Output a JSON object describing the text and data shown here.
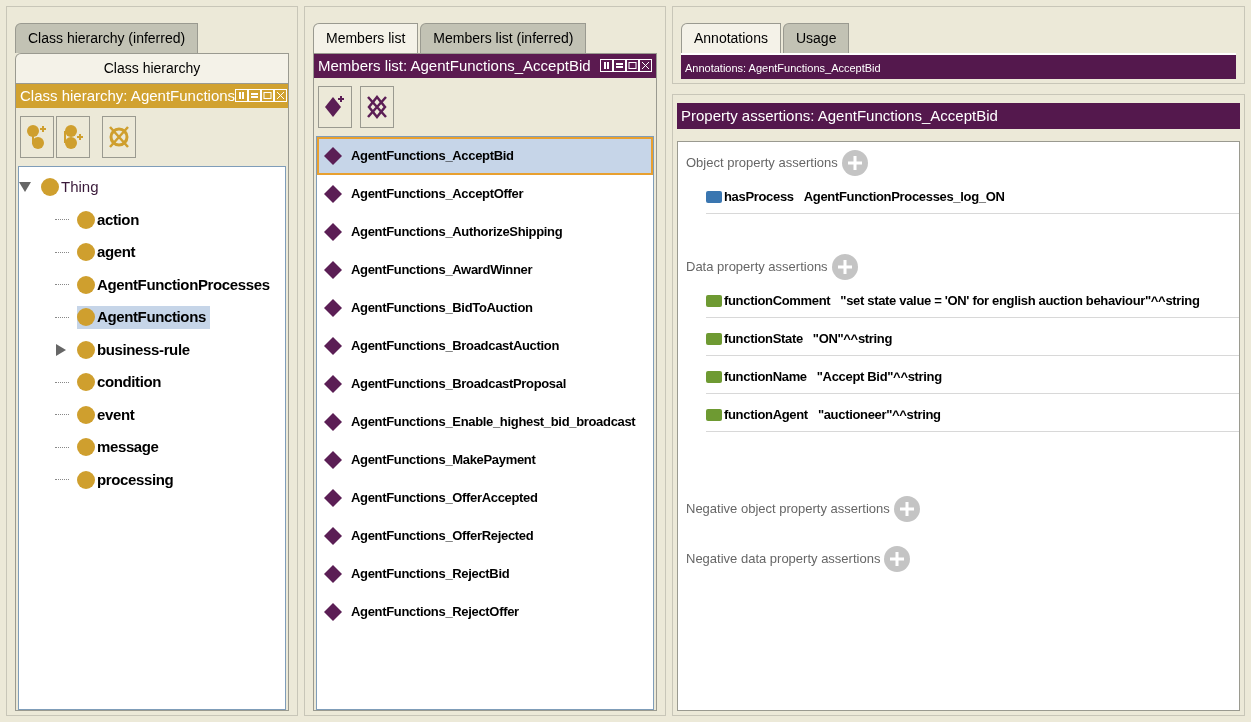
{
  "class_panel": {
    "tabs": [
      {
        "label": "Class hierarchy (inferred)",
        "selected": false
      },
      {
        "label": "Class hierarchy",
        "selected": true
      }
    ],
    "header": "Class hierarchy: AgentFunctions",
    "tree": [
      {
        "label": "Thing",
        "expanded": true,
        "selected": false,
        "children": [
          {
            "label": "action",
            "selected": false
          },
          {
            "label": "agent",
            "selected": false
          },
          {
            "label": "AgentFunctionProcesses",
            "selected": false
          },
          {
            "label": "AgentFunctions",
            "selected": true
          },
          {
            "label": "business-rule",
            "selected": false,
            "expanded": false
          },
          {
            "label": "condition",
            "selected": false
          },
          {
            "label": "event",
            "selected": false
          },
          {
            "label": "message",
            "selected": false
          },
          {
            "label": "processing",
            "selected": false
          }
        ]
      }
    ]
  },
  "members_panel": {
    "tabs": [
      {
        "label": "Members list",
        "selected": true
      },
      {
        "label": "Members list (inferred)",
        "selected": false
      }
    ],
    "header": "Members list: AgentFunctions_AcceptBid",
    "items": [
      {
        "label": "AgentFunctions_AcceptBid",
        "selected": true
      },
      {
        "label": "AgentFunctions_AcceptOffer",
        "selected": false
      },
      {
        "label": "AgentFunctions_AuthorizeShipping",
        "selected": false
      },
      {
        "label": "AgentFunctions_AwardWinner",
        "selected": false
      },
      {
        "label": "AgentFunctions_BidToAuction",
        "selected": false
      },
      {
        "label": "AgentFunctions_BroadcastAuction",
        "selected": false
      },
      {
        "label": "AgentFunctions_BroadcastProposal",
        "selected": false
      },
      {
        "label": "AgentFunctions_Enable_highest_bid_broadcast",
        "selected": false
      },
      {
        "label": "AgentFunctions_MakePayment",
        "selected": false
      },
      {
        "label": "AgentFunctions_OfferAccepted",
        "selected": false
      },
      {
        "label": "AgentFunctions_OfferRejected",
        "selected": false
      },
      {
        "label": "AgentFunctions_RejectBid",
        "selected": false
      },
      {
        "label": "AgentFunctions_RejectOffer",
        "selected": false
      }
    ]
  },
  "details_panel": {
    "tabs": [
      {
        "label": "Annotations",
        "selected": true
      },
      {
        "label": "Usage",
        "selected": false
      }
    ],
    "annotations_header": "Annotations: AgentFunctions_AcceptBid",
    "assertions_header": "Property assertions: AgentFunctions_AcceptBid",
    "sections": [
      {
        "title": "Object property assertions",
        "items": [
          {
            "kind": "object",
            "property": "hasProcess",
            "value": "AgentFunctionProcesses_log_ON"
          }
        ]
      },
      {
        "title": "Data property assertions",
        "items": [
          {
            "kind": "data",
            "property": "functionComment",
            "value": "\"set state value = 'ON' for english auction behaviour\"^^string"
          },
          {
            "kind": "data",
            "property": "functionState",
            "value": "\"ON\"^^string"
          },
          {
            "kind": "data",
            "property": "functionName",
            "value": "\"Accept Bid\"^^string"
          },
          {
            "kind": "data",
            "property": "functionAgent",
            "value": "\"auctioneer\"^^string"
          }
        ]
      },
      {
        "title": "Negative object property assertions"
      },
      {
        "title": "Negative data property assertions"
      }
    ]
  }
}
